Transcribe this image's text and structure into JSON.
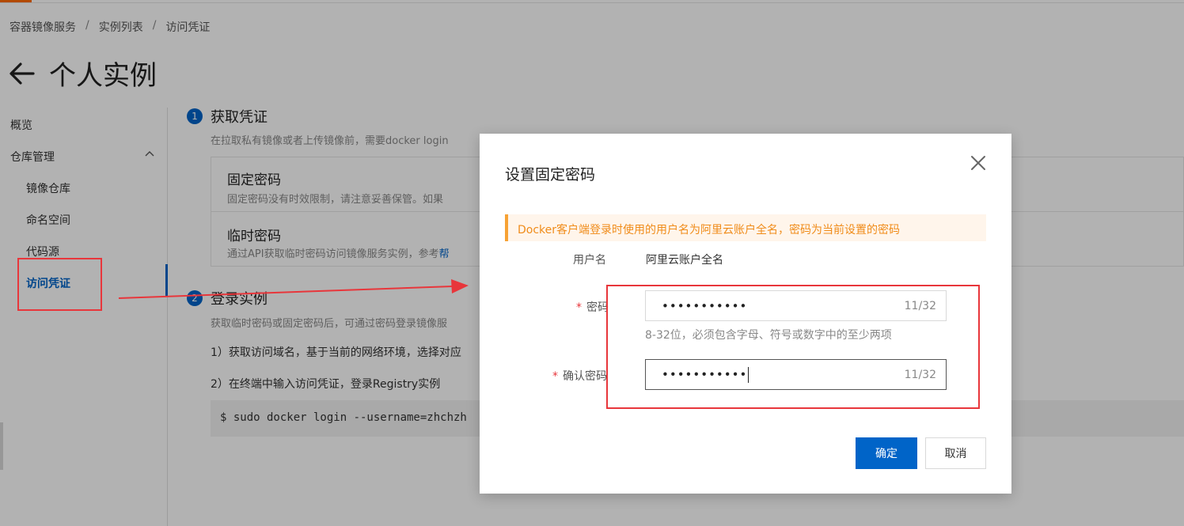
{
  "breadcrumb": [
    "容器镜像服务",
    "实例列表",
    "访问凭证"
  ],
  "page": {
    "title": "个人实例"
  },
  "sidebar": {
    "items": [
      {
        "label": "概览"
      },
      {
        "label": "仓库管理"
      },
      {
        "label": "镜像仓库"
      },
      {
        "label": "命名空间"
      },
      {
        "label": "代码源"
      },
      {
        "label": "访问凭证"
      }
    ]
  },
  "steps": [
    {
      "num": "1",
      "title": "获取凭证",
      "desc": "在拉取私有镜像或者上传镜像前，需要docker login",
      "cards": [
        {
          "title": "固定密码",
          "desc": "固定密码没有时效限制，请注意妥善保管。如果",
          "link": ""
        },
        {
          "title": "临时密码",
          "desc": "通过API获取临时密码访问镜像服务实例，参考",
          "link": "帮"
        }
      ]
    },
    {
      "num": "2",
      "title": "登录实例",
      "desc": "获取临时密码或固定密码后，可通过密码登录镜像服",
      "lines": [
        "1）获取访问域名，基于当前的网络环境，选择对应",
        "2）在终端中输入访问凭证，登录Registry实例"
      ],
      "code": "$ sudo docker login --username=zhchzh"
    }
  ],
  "dialog": {
    "title": "设置固定密码",
    "notice": "Docker客户端登录时使用的用户名为阿里云账户全名，密码为当前设置的密码",
    "username_label": "用户名",
    "username_value": "阿里云账户全名",
    "password_label": "密码",
    "password_value": "•••••••••••",
    "password_count": "11/32",
    "password_help": "8-32位，必须包含字母、符号或数字中的至少两项",
    "confirm_label": "确认密码",
    "confirm_value": "•••••••••••",
    "confirm_count": "11/32",
    "ok_label": "确定",
    "cancel_label": "取消"
  },
  "colors": {
    "primary": "#0064c8",
    "annotation": "#e8363b",
    "warning": "#f08c1a"
  }
}
